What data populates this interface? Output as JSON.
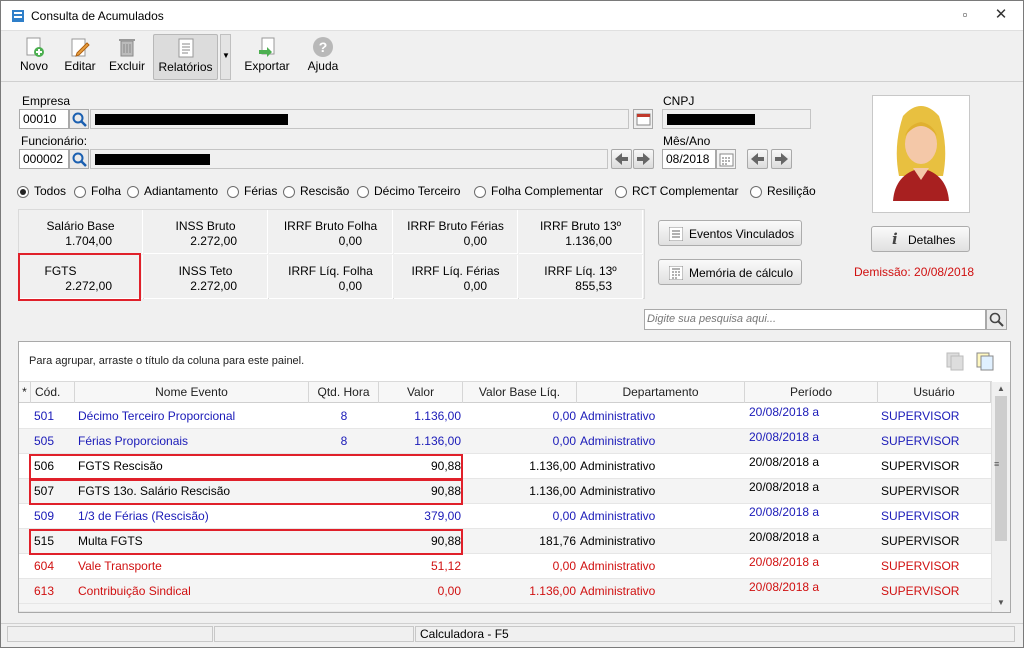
{
  "window": {
    "title": "Consulta de Acumulados"
  },
  "toolbar": {
    "novo": "Novo",
    "editar": "Editar",
    "excluir": "Excluir",
    "relatorios": "Relatórios",
    "exportar": "Exportar",
    "ajuda": "Ajuda"
  },
  "form": {
    "empresa_label": "Empresa",
    "empresa_code": "00010",
    "funcionario_label": "Funcionário:",
    "funcionario_code": "000002",
    "cnpj_label": "CNPJ",
    "mesano_label": "Mês/Ano",
    "mesano_value": "08/2018"
  },
  "filters": {
    "selected": "Todos",
    "options": [
      "Todos",
      "Folha",
      "Adiantamento",
      "Férias",
      "Rescisão",
      "Décimo Terceiro",
      "Folha Complementar",
      "RCT Complementar",
      "Resilição"
    ]
  },
  "summary": [
    {
      "title": "Salário Base",
      "value": "1.704,00"
    },
    {
      "title": "INSS Bruto",
      "value": "2.272,00"
    },
    {
      "title": "IRRF Bruto Folha",
      "value": "0,00"
    },
    {
      "title": "IRRF Bruto Férias",
      "value": "0,00"
    },
    {
      "title": "IRRF Bruto 13º",
      "value": "1.136,00"
    },
    {
      "title": "FGTS",
      "value": "2.272,00"
    },
    {
      "title": "INSS Teto",
      "value": "2.272,00"
    },
    {
      "title": "IRRF Líq. Folha",
      "value": "0,00"
    },
    {
      "title": "IRRF Líq. Férias",
      "value": "0,00"
    },
    {
      "title": "IRRF Líq. 13º",
      "value": "855,53"
    }
  ],
  "actions": {
    "eventos": "Eventos Vinculados",
    "memoria": "Memória de cálculo",
    "detalhes": "Detalhes",
    "demissao": "Demissão: 20/08/2018"
  },
  "search": {
    "placeholder": "Digite sua pesquisa aqui..."
  },
  "grid": {
    "group_hint": "Para agrupar, arraste o título da coluna para este painel.",
    "headers": [
      "*",
      "Cód.",
      "Nome Evento",
      "Qtd. Hora",
      "Valor",
      "Valor Base Líq.",
      "Departamento",
      "Período",
      "Usuário"
    ],
    "rows": [
      {
        "cod": "501",
        "nome": "Décimo Terceiro Proporcional",
        "qtd": "8",
        "valor": "1.136,00",
        "base": "0,00",
        "dep": "Administrativo",
        "periodo": "20/08/2018 a",
        "usuario": "SUPERVISOR",
        "color": "#1a1ab8"
      },
      {
        "cod": "505",
        "nome": "Férias Proporcionais",
        "qtd": "8",
        "valor": "1.136,00",
        "base": "0,00",
        "dep": "Administrativo",
        "periodo": "20/08/2018 a",
        "usuario": "SUPERVISOR",
        "color": "#1a1ab8"
      },
      {
        "cod": "506",
        "nome": "FGTS Rescisão",
        "qtd": "",
        "valor": "90,88",
        "base": "1.136,00",
        "dep": "Administrativo",
        "periodo": "20/08/2018 a",
        "usuario": "SUPERVISOR",
        "color": "#000000"
      },
      {
        "cod": "507",
        "nome": "FGTS 13o. Salário Rescisão",
        "qtd": "",
        "valor": "90,88",
        "base": "1.136,00",
        "dep": "Administrativo",
        "periodo": "20/08/2018 a",
        "usuario": "SUPERVISOR",
        "color": "#000000"
      },
      {
        "cod": "509",
        "nome": "1/3 de Férias (Rescisão)",
        "qtd": "",
        "valor": "379,00",
        "base": "0,00",
        "dep": "Administrativo",
        "periodo": "20/08/2018 a",
        "usuario": "SUPERVISOR",
        "color": "#1a1ab8"
      },
      {
        "cod": "515",
        "nome": "Multa FGTS",
        "qtd": "",
        "valor": "90,88",
        "base": "181,76",
        "dep": "Administrativo",
        "periodo": "20/08/2018 a",
        "usuario": "SUPERVISOR",
        "color": "#000000"
      },
      {
        "cod": "604",
        "nome": "Vale Transporte",
        "qtd": "",
        "valor": "51,12",
        "base": "0,00",
        "dep": "Administrativo",
        "periodo": "20/08/2018 a",
        "usuario": "SUPERVISOR",
        "color": "#d01010"
      },
      {
        "cod": "613",
        "nome": "Contribuição Sindical",
        "qtd": "",
        "valor": "0,00",
        "base": "1.136,00",
        "dep": "Administrativo",
        "periodo": "20/08/2018 a",
        "usuario": "SUPERVISOR",
        "color": "#d01010"
      }
    ]
  },
  "status": {
    "calc": "Calculadora - F5"
  }
}
